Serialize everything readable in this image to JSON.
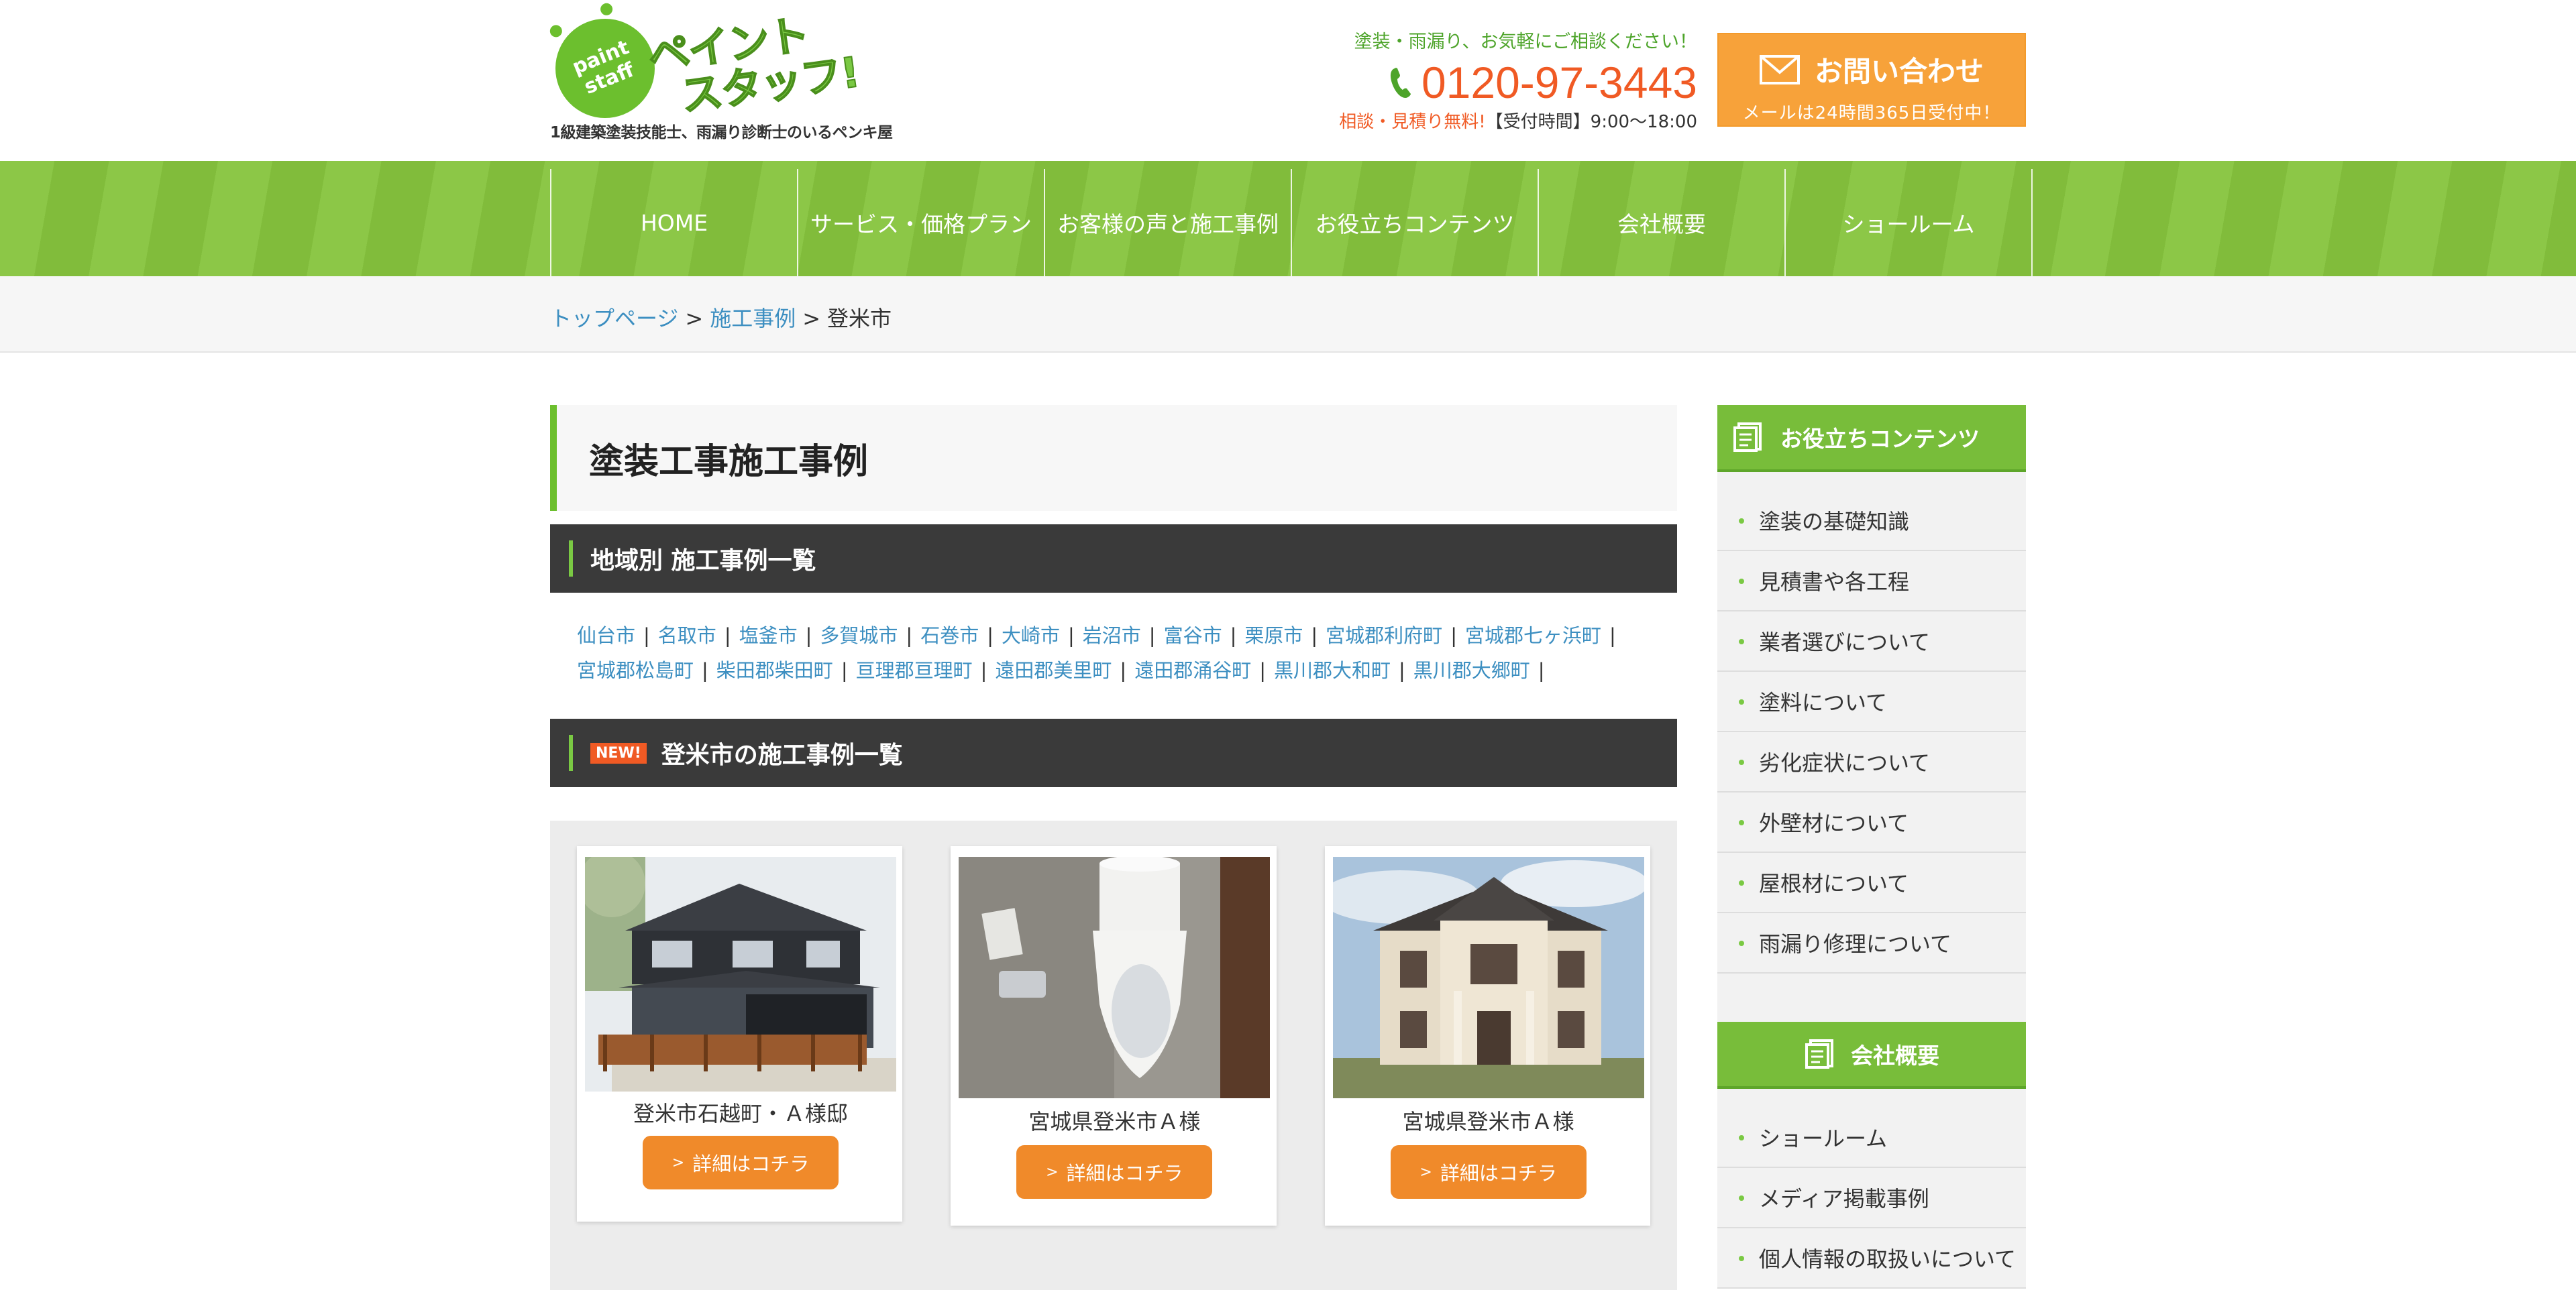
{
  "header": {
    "logo": {
      "badge_line1": "paint",
      "badge_line2": "staff",
      "name_line1": "ペイント",
      "name_line2": "スタッフ!",
      "tagline": "1級建築塗装技能士、雨漏り診断士のいるペンキ屋"
    },
    "contact": {
      "top": "塗装・雨漏り、お気軽にご相談ください！",
      "phone": "0120-97-3443",
      "free": "相談・見積り無料!",
      "hours": "【受付時間】9:00〜18:00"
    },
    "inquiry": {
      "title": "お問い合わせ",
      "sub": "メールは24時間365日受付中！"
    }
  },
  "nav": {
    "items": [
      "HOME",
      "サービス・価格プラン",
      "お客様の声と施工事例",
      "お役立ちコンテンツ",
      "会社概要",
      "ショールーム"
    ]
  },
  "breadcrumb": {
    "home": "トップページ",
    "sep": ">",
    "cases": "施工事例",
    "current": "登米市"
  },
  "main": {
    "page_title": "塗装工事施工事例",
    "regions_heading": "地域別 施工事例一覧",
    "regions": [
      "仙台市",
      "名取市",
      "塩釜市",
      "多賀城市",
      "石巻市",
      "大崎市",
      "岩沼市",
      "富谷市",
      "栗原市",
      "宮城郡利府町",
      "宮城郡七ヶ浜町",
      "宮城郡松島町",
      "柴田郡柴田町",
      "亘理郡亘理町",
      "遠田郡美里町",
      "遠田郡涌谷町",
      "黒川郡大和町",
      "黒川郡大郷町"
    ],
    "region_sep": "|",
    "new_badge": "NEW!",
    "list_heading": "登米市の施工事例一覧",
    "cases": [
      {
        "title": "登米市石越町・Ａ様邸",
        "button": "詳細はコチラ",
        "image": "two-story-house-photo"
      },
      {
        "title": "宮城県登米市Ａ様",
        "button": "詳細はコチラ",
        "image": "toilet-photo"
      },
      {
        "title": "宮城県登米市Ａ様",
        "button": "詳細はコチラ",
        "image": "beige-house-photo"
      }
    ]
  },
  "sidebar": {
    "useful": {
      "heading": "お役立ちコンテンツ",
      "items": [
        "塗装の基礎知識",
        "見積書や各工程",
        "業者選びについて",
        "塗料について",
        "劣化症状について",
        "外壁材について",
        "屋根材について",
        "雨漏り修理について"
      ]
    },
    "company": {
      "heading": "会社概要",
      "items": [
        "ショールーム",
        "メディア掲載事例",
        "個人情報の取扱いについて"
      ]
    }
  },
  "colors": {
    "brand_green": "#7ac943",
    "accent_orange": "#f05a24",
    "button_orange": "#f08a2a",
    "link_blue": "#3d8fc1",
    "dark_bar": "#3a3a3a"
  }
}
